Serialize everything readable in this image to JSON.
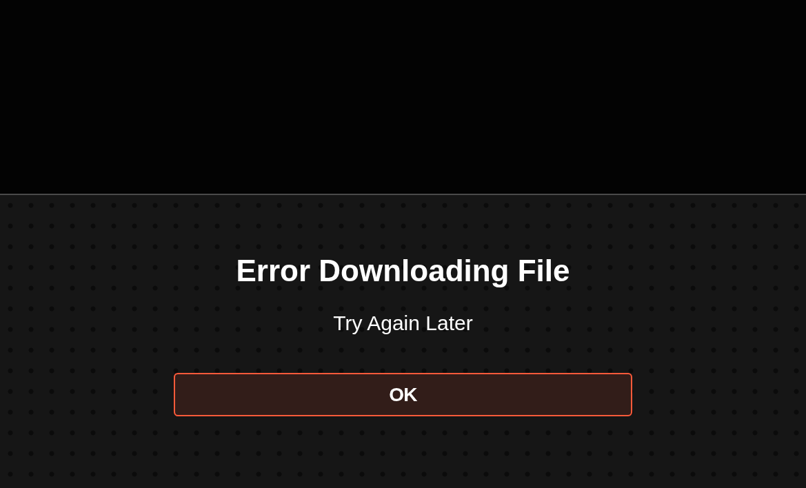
{
  "dialog": {
    "title": "Error Downloading File",
    "message": "Try Again Later",
    "buttons": [
      {
        "label": "OK",
        "focused": true
      }
    ]
  }
}
